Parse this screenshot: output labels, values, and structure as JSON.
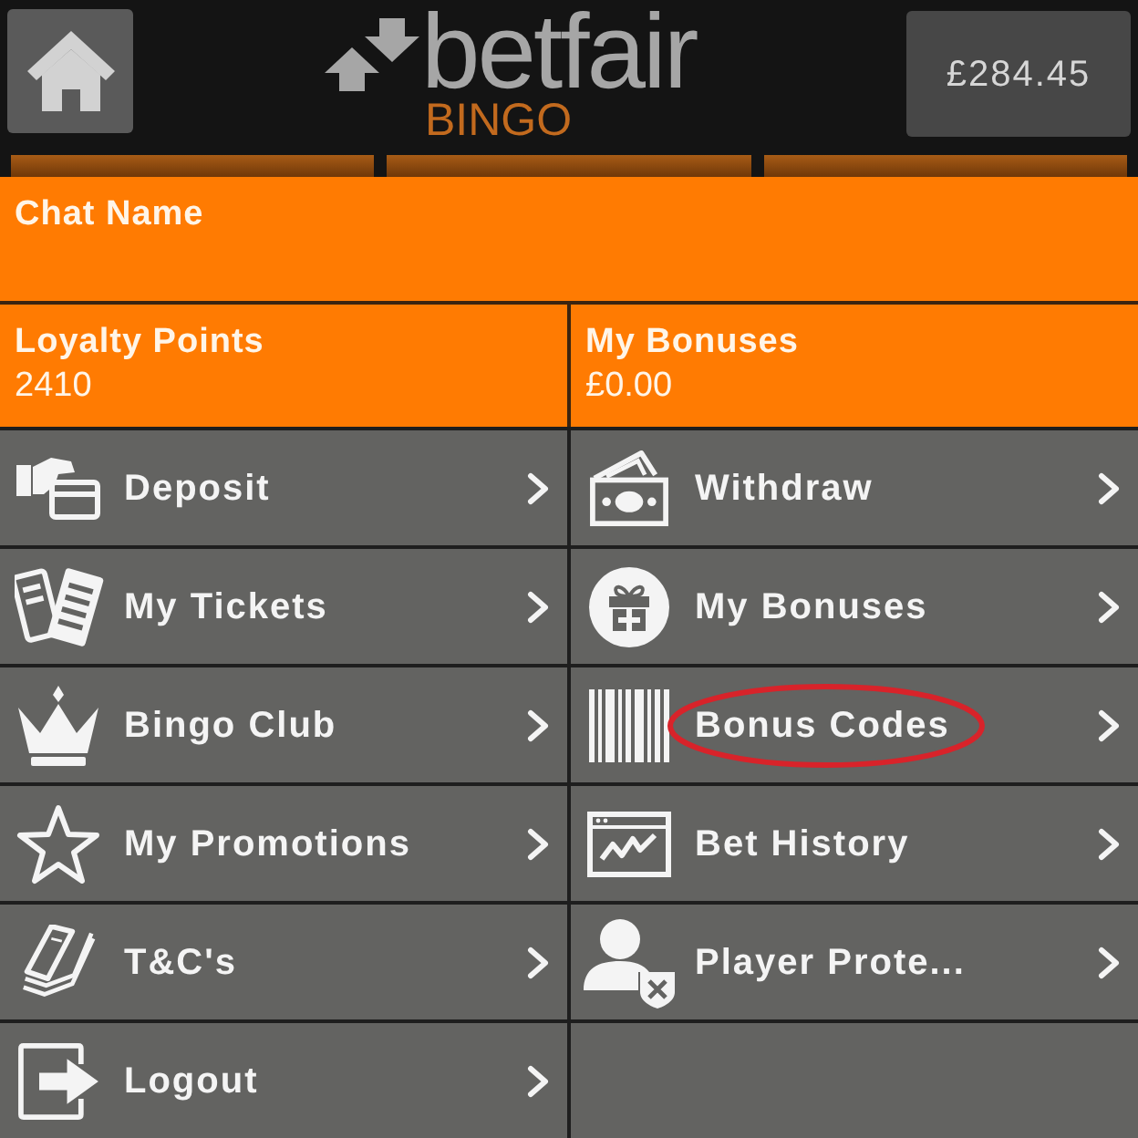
{
  "header": {
    "logo": "betfair",
    "logo_subtitle": "BINGO",
    "balance": "£284.45"
  },
  "chat": {
    "label": "Chat Name"
  },
  "summary": [
    {
      "label": "Loyalty Points",
      "value": "2410"
    },
    {
      "label": "My Bonuses",
      "value": "£0.00"
    }
  ],
  "menu": [
    {
      "label": "Deposit",
      "circled": false
    },
    {
      "label": "Withdraw",
      "circled": false
    },
    {
      "label": "My Tickets",
      "circled": false
    },
    {
      "label": "My Bonuses",
      "circled": false
    },
    {
      "label": "Bingo Club",
      "circled": false
    },
    {
      "label": "Bonus Codes",
      "circled": true
    },
    {
      "label": "My Promotions",
      "circled": false
    },
    {
      "label": "Bet History",
      "circled": false
    },
    {
      "label": "T&C's",
      "circled": false
    },
    {
      "label": "Player Prote...",
      "circled": false
    },
    {
      "label": "Logout",
      "circled": false
    }
  ]
}
